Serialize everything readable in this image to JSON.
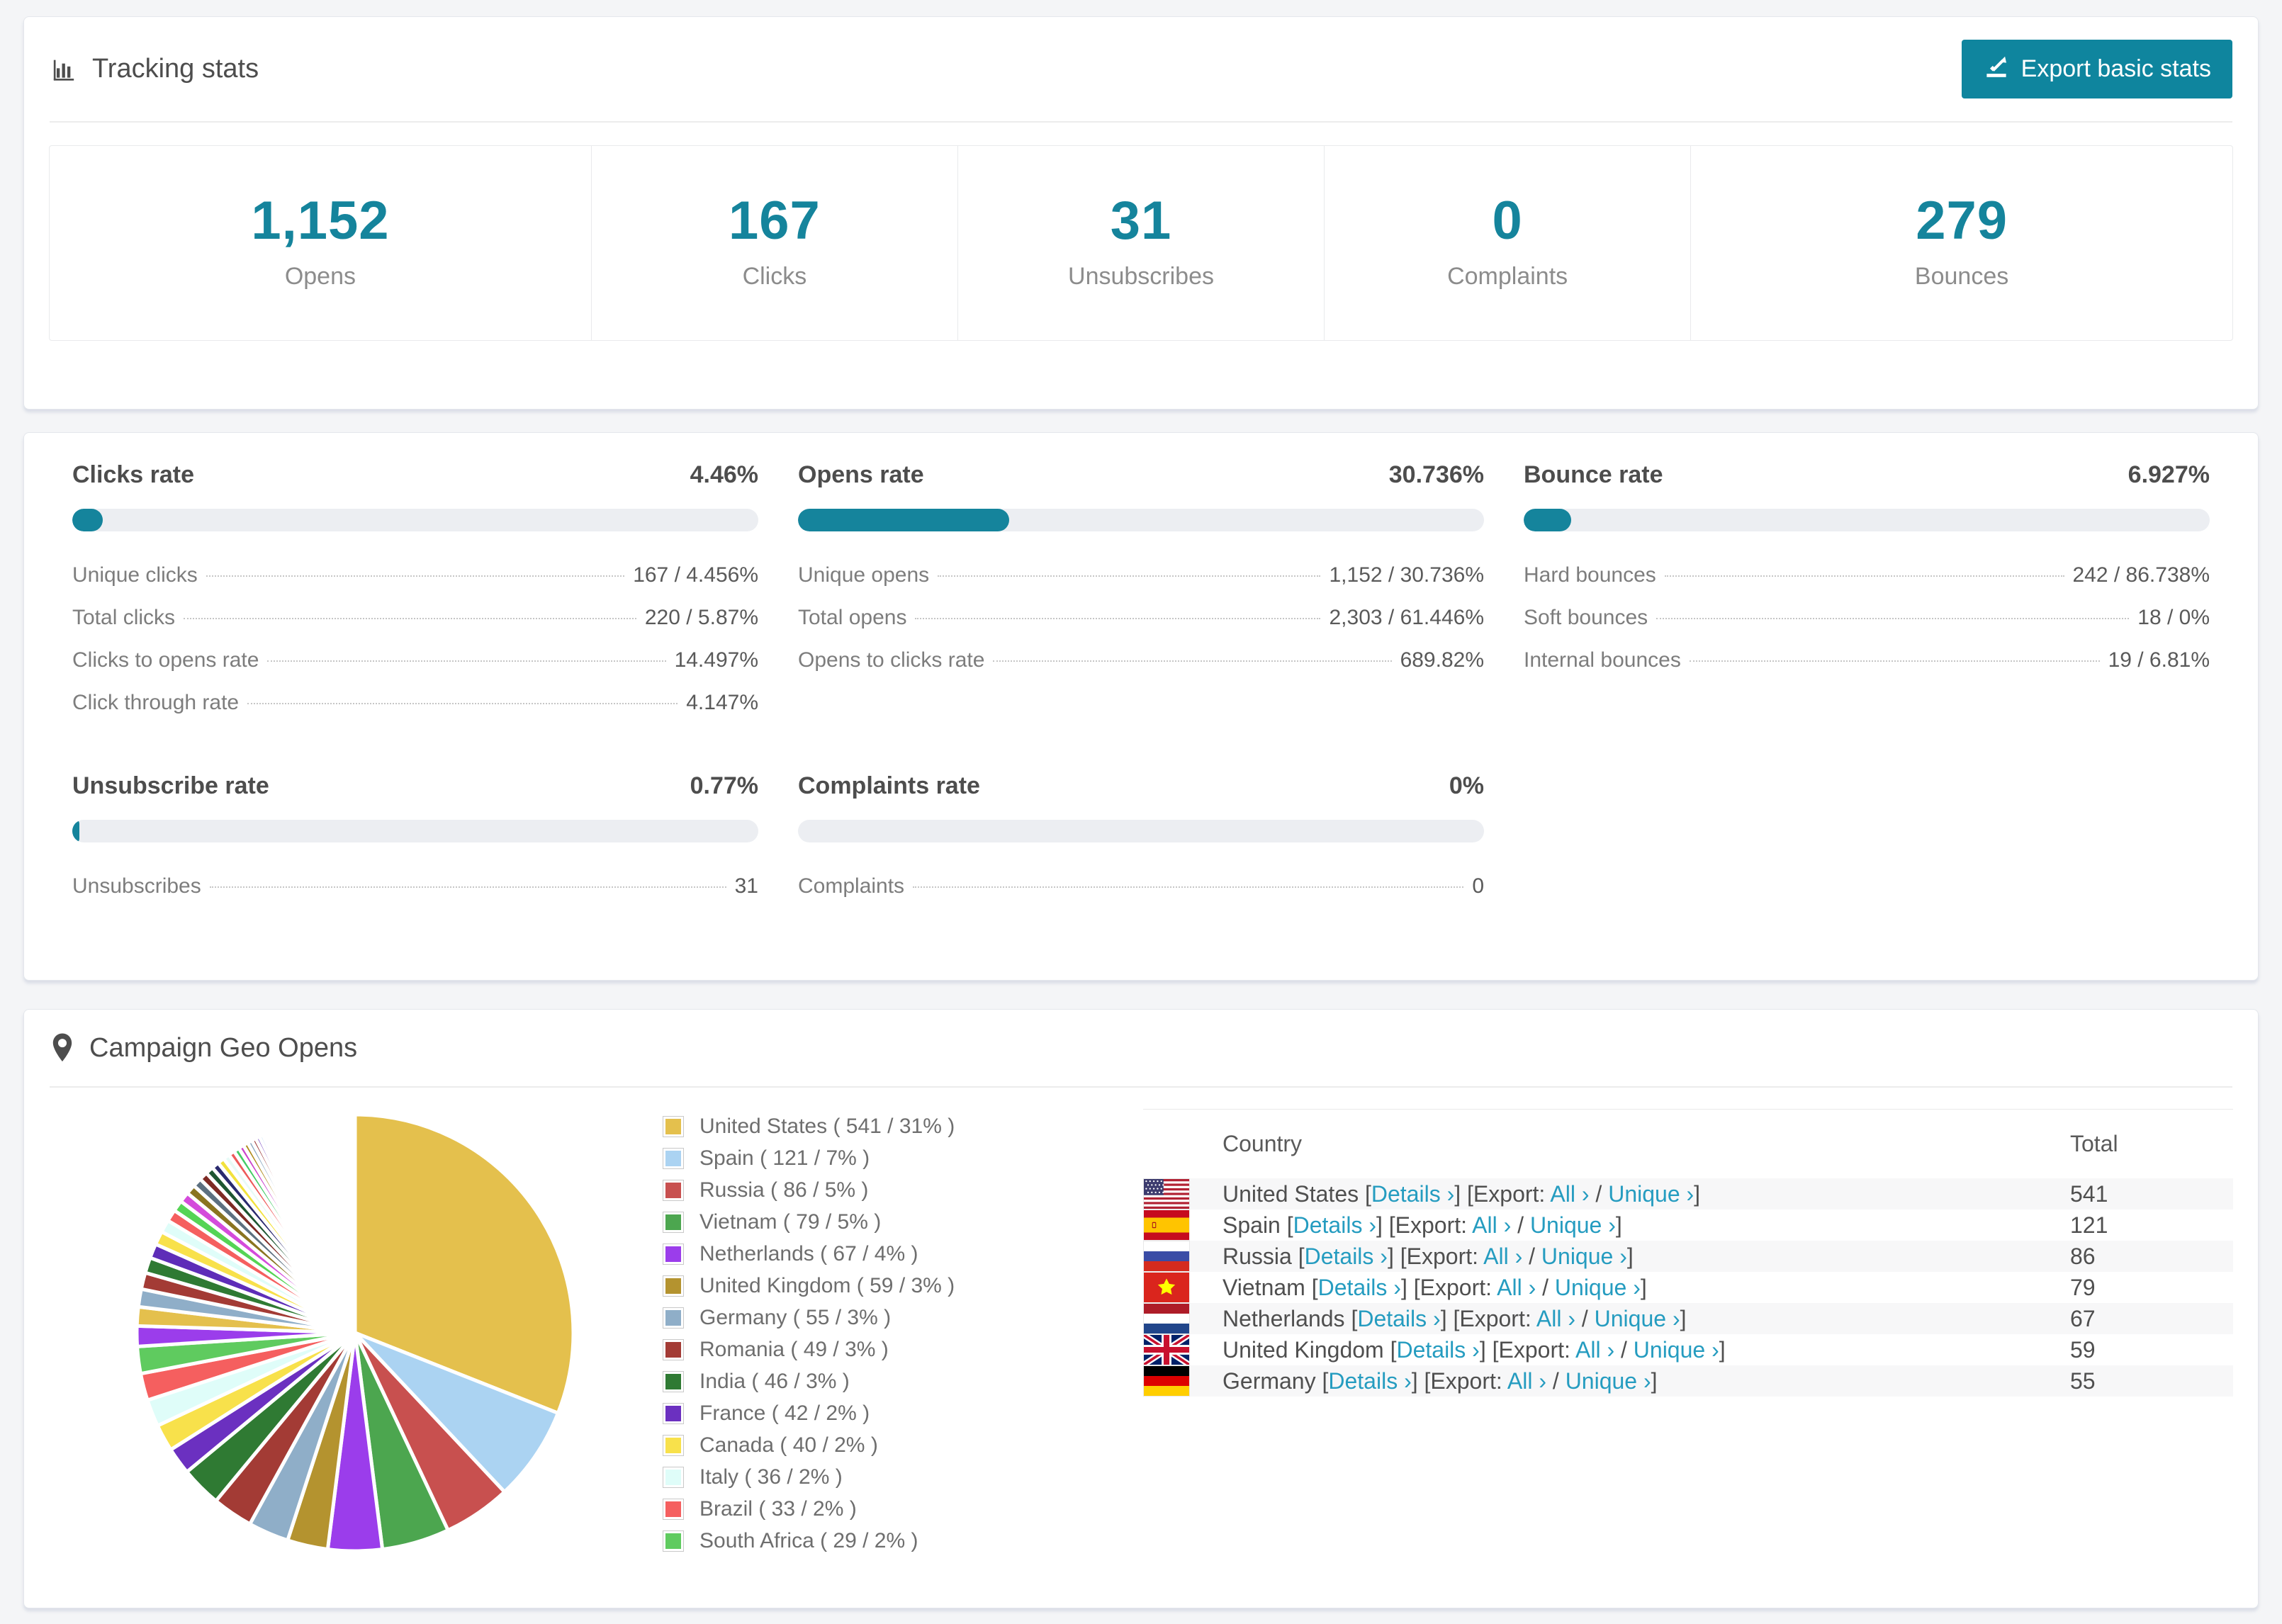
{
  "accent": "#15849c",
  "link_color": "#259cc0",
  "tracking": {
    "title": "Tracking stats",
    "export_button": "Export basic stats"
  },
  "summary_stats": [
    {
      "value": "1,152",
      "label": "Opens"
    },
    {
      "value": "167",
      "label": "Clicks"
    },
    {
      "value": "31",
      "label": "Unsubscribes"
    },
    {
      "value": "0",
      "label": "Complaints"
    },
    {
      "value": "279",
      "label": "Bounces"
    }
  ],
  "rates": [
    {
      "title": "Clicks rate",
      "value": "4.46%",
      "bar_pct": 4.46,
      "rows": [
        {
          "label": "Unique clicks",
          "value": "167 / 4.456%"
        },
        {
          "label": "Total clicks",
          "value": "220 / 5.87%"
        },
        {
          "label": "Clicks to opens rate",
          "value": "14.497%"
        },
        {
          "label": "Click through rate",
          "value": "4.147%"
        }
      ]
    },
    {
      "title": "Opens rate",
      "value": "30.736%",
      "bar_pct": 30.736,
      "rows": [
        {
          "label": "Unique opens",
          "value": "1,152 / 30.736%"
        },
        {
          "label": "Total opens",
          "value": "2,303 / 61.446%"
        },
        {
          "label": "Opens to clicks rate",
          "value": "689.82%"
        }
      ]
    },
    {
      "title": "Bounce rate",
      "value": "6.927%",
      "bar_pct": 6.927,
      "rows": [
        {
          "label": "Hard bounces",
          "value": "242 / 86.738%"
        },
        {
          "label": "Soft bounces",
          "value": "18 / 0%"
        },
        {
          "label": "Internal bounces",
          "value": "19 / 6.81%"
        }
      ]
    },
    {
      "title": "Unsubscribe rate",
      "value": "0.77%",
      "bar_pct": 0.77,
      "rows": [
        {
          "label": "Unsubscribes",
          "value": "31"
        }
      ]
    },
    {
      "title": "Complaints rate",
      "value": "0%",
      "bar_pct": 0,
      "rows": [
        {
          "label": "Complaints",
          "value": "0"
        }
      ]
    }
  ],
  "geo": {
    "title": "Campaign Geo Opens",
    "columns": {
      "country": "Country",
      "total": "Total"
    },
    "links": {
      "details": "Details",
      "all": "All",
      "unique": "Unique",
      "export_label": "Export:",
      "chevron": "›"
    },
    "rows": [
      {
        "country": "United States",
        "total": "541",
        "flag": "us"
      },
      {
        "country": "Spain",
        "total": "121",
        "flag": "es"
      },
      {
        "country": "Russia",
        "total": "86",
        "flag": "ru"
      },
      {
        "country": "Vietnam",
        "total": "79",
        "flag": "vn"
      },
      {
        "country": "Netherlands",
        "total": "67",
        "flag": "nl"
      },
      {
        "country": "United Kingdom",
        "total": "59",
        "flag": "gb"
      },
      {
        "country": "Germany",
        "total": "55",
        "flag": "de"
      }
    ]
  },
  "chart_data": {
    "type": "pie",
    "title": "Campaign Geo Opens",
    "unit": "opens",
    "start_angle_deg": -90,
    "direction": "clockwise",
    "legend_position": "right",
    "slices": [
      {
        "label": "United States",
        "value": 541,
        "pct": 31,
        "color": "#E4C04D",
        "legend": "United States ( 541 / 31% )"
      },
      {
        "label": "Spain",
        "value": 121,
        "pct": 7,
        "color": "#ABD3F2",
        "legend": "Spain ( 121 / 7% )"
      },
      {
        "label": "Russia",
        "value": 86,
        "pct": 5,
        "color": "#C8504F",
        "legend": "Russia ( 86 / 5% )"
      },
      {
        "label": "Vietnam",
        "value": 79,
        "pct": 5,
        "color": "#4CA64F",
        "legend": "Vietnam ( 79 / 5% )"
      },
      {
        "label": "Netherlands",
        "value": 67,
        "pct": 4,
        "color": "#9B3DEB",
        "legend": "Netherlands ( 67 / 4% )"
      },
      {
        "label": "United Kingdom",
        "value": 59,
        "pct": 3,
        "color": "#B4932F",
        "legend": "United Kingdom ( 59 / 3% )"
      },
      {
        "label": "Germany",
        "value": 55,
        "pct": 3,
        "color": "#8FAEC8",
        "legend": "Germany ( 55 / 3% )"
      },
      {
        "label": "Romania",
        "value": 49,
        "pct": 3,
        "color": "#A33B35",
        "legend": "Romania ( 49 / 3% )"
      },
      {
        "label": "India",
        "value": 46,
        "pct": 3,
        "color": "#2F7A33",
        "legend": "India ( 46 / 3% )"
      },
      {
        "label": "France",
        "value": 42,
        "pct": 2,
        "color": "#6B30C0",
        "legend": "France ( 42 / 2% )"
      },
      {
        "label": "Canada",
        "value": 40,
        "pct": 2,
        "color": "#F8E14B",
        "legend": "Canada ( 40 / 2% )"
      },
      {
        "label": "Italy",
        "value": 36,
        "pct": 2,
        "color": "#DFFDF9",
        "legend": "Italy ( 36 / 2% )"
      },
      {
        "label": "Brazil",
        "value": 33,
        "pct": 2,
        "color": "#F55F5F",
        "legend": "Brazil ( 33 / 2% )"
      },
      {
        "label": "South Africa",
        "value": 29,
        "pct": 2,
        "color": "#5FCB5F",
        "legend": "South Africa ( 29 / 2% )"
      }
    ],
    "other_unlabeled": {
      "approx_total_pct": 26,
      "note": "many small unlabeled countries rendered as thin slices fading out before 12 o'clock",
      "tail_start_pct": 1.5,
      "tail_decay": 0.935,
      "tail_count": 60
    },
    "tail_palette": [
      "#9B3DEB",
      "#E4C04D",
      "#8FAEC8",
      "#A33B35",
      "#2F7A33",
      "#5E2DB8",
      "#F8E14B",
      "#DFFDF9",
      "#F55F5F",
      "#55D455",
      "#D44BDB",
      "#8A7420",
      "#5C7080",
      "#7E2A24",
      "#1E5631",
      "#2A2A6E",
      "#F2E23C",
      "#E8FBF7",
      "#EE5A5A",
      "#44CC66",
      "#CC44CC",
      "#B08C1E",
      "#88A6C0",
      "#993333",
      "#6633BB",
      "#ABD3F2",
      "#C8504F",
      "#4CA64F"
    ]
  }
}
